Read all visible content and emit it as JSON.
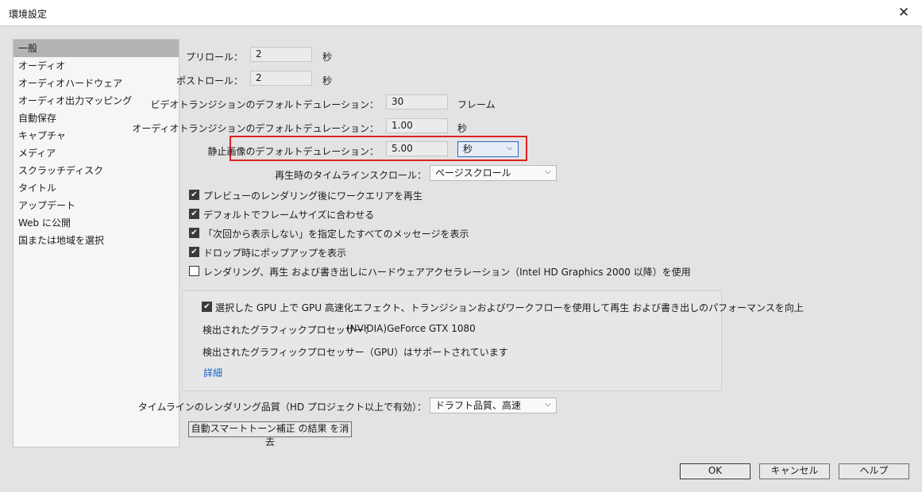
{
  "window": {
    "title": "環境設定",
    "close_glyph": "✕"
  },
  "sidebar": {
    "items": [
      {
        "label": "一般",
        "selected": true
      },
      {
        "label": "オーディオ"
      },
      {
        "label": "オーディオハードウェア"
      },
      {
        "label": "オーディオ出力マッピング"
      },
      {
        "label": "自動保存"
      },
      {
        "label": "キャプチャ"
      },
      {
        "label": "メディア"
      },
      {
        "label": "スクラッチディスク"
      },
      {
        "label": "タイトル"
      },
      {
        "label": "アップデート"
      },
      {
        "label": "Web に公開"
      },
      {
        "label": "国または地域を選択"
      }
    ]
  },
  "general": {
    "preroll": {
      "label": "プリロール：",
      "value": "2",
      "unit": "秒"
    },
    "postroll": {
      "label": "ポストロール：",
      "value": "2",
      "unit": "秒"
    },
    "video_transition": {
      "label": "ビデオトランジションのデフォルトデュレーション：",
      "value": "30",
      "unit": "フレーム"
    },
    "audio_transition": {
      "label": "オーディオトランジションのデフォルトデュレーション：",
      "value": "1.00",
      "unit": "秒"
    },
    "still_image": {
      "label": "静止画像のデフォルトデュレーション：",
      "value": "5.00",
      "unit_select": "秒"
    },
    "timeline_scroll": {
      "label": "再生時のタイムラインスクロール：",
      "value": "ページスクロール"
    },
    "checkboxes": [
      {
        "label": "プレビューのレンダリング後にワークエリアを再生",
        "checked": true
      },
      {
        "label": "デフォルトでフレームサイズに合わせる",
        "checked": true
      },
      {
        "label": "「次回から表示しない」を指定したすべてのメッセージを表示",
        "checked": true
      },
      {
        "label": "ドロップ時にポップアップを表示",
        "checked": true
      },
      {
        "label": "レンダリング、再生 および書き出しにハードウェアアクセラレーション（Intel HD Graphics 2000 以降）を使用",
        "checked": false
      }
    ],
    "gpu": {
      "checkbox_label": "選択した GPU 上で GPU 高速化エフェクト、トランジションおよびワークフローを使用して再生 および書き出しのパフォーマンスを向上",
      "checked": true,
      "detected_label": "検出されたグラフィックプロセッサー：",
      "detected_value": "(NVIDIA)GeForce GTX 1080",
      "support_text": "検出されたグラフィックプロセッサー（GPU）はサポートされています",
      "details_link": "詳細"
    },
    "render_quality": {
      "label": "タイムラインのレンダリング品質（HD プロジェクト以上で有効）：",
      "value": "ドラフト品質、高速"
    },
    "clear_button": "自動スマートトーン補正 の結果 を消去"
  },
  "footer": {
    "ok": "OK",
    "cancel": "キャンセル",
    "help": "ヘルプ"
  },
  "colors": {
    "highlight": "#e02020",
    "link": "#1762c8",
    "selected": "#b4b4b4"
  }
}
